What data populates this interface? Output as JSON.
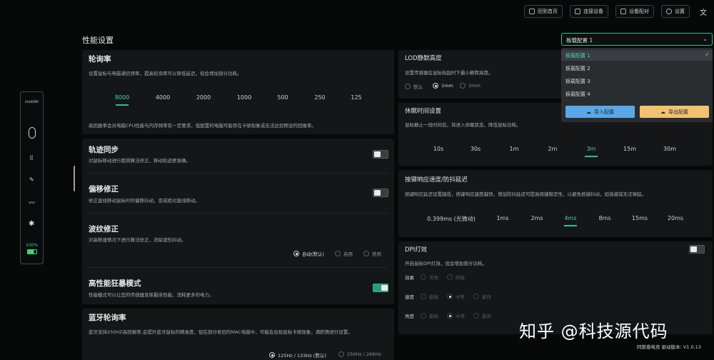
{
  "topbar": {
    "home": "回到首页",
    "connect": "连接设备",
    "device_config": "设备配对",
    "settings": "设置"
  },
  "page_title": "性能设置",
  "profile": {
    "selected": "板载配置 1",
    "options": [
      "板载配置 1",
      "板载配置 2",
      "板载配置 3",
      "板载配置 4"
    ],
    "import_label": "导入配置",
    "export_label": "导出配置"
  },
  "sidebar": {
    "logo": "AULEDRR",
    "battery": "100%"
  },
  "polling": {
    "title": "轮询率",
    "desc": "设置鼠标与电脑通信频率，提高轮询率可以降低延迟，但会增加部分功耗。",
    "options": [
      "8000",
      "4000",
      "2000",
      "1000",
      "500",
      "250",
      "125"
    ],
    "selected": "8000",
    "note": "高回报率会对电脑CPU性能与内存频率有一定要求，低配置的电脑可能存在卡顿现象或无法达到预设的回报率。"
  },
  "track_sync": {
    "title": "轨迹同步",
    "desc": "对鼠标移动进行圆滑算法修正，移动轨迹更准确。",
    "enabled": false
  },
  "offset": {
    "title": "偏移修正",
    "desc": "修正直线移动鼠标时的偏移抖动，变成绝对直线移动。",
    "enabled": false
  },
  "ripple": {
    "title": "波纹修正",
    "desc": "对高移速情况下进行算法修正，消除波形抖动。",
    "options": [
      "自动(默认)",
      "启用",
      "禁用"
    ],
    "selected": "自动(默认)"
  },
  "high_perf": {
    "title": "高性能狂暴模式",
    "desc": "性能模式可以让您的传感器发挥最佳性能，消耗更多的电力。",
    "enabled": true
  },
  "bt_polling": {
    "title": "蓝牙轮询率",
    "desc": "蓝牙支持250HZ高回报率,会提升蓝牙鼠标的精准度，但在部分老旧的MAC电脑中，可能会出现鼠标卡顿现象，请酌情进行设置。",
    "options": [
      "125Hz / 133Hz (默认)",
      "250Hz / 266Hz"
    ],
    "selected": "125Hz / 133Hz (默认)"
  },
  "lod": {
    "title": "LOD静默高度",
    "desc": "设置传感器在鼠标抬起时下最小静默高度。",
    "options": [
      "默认",
      "1mm",
      "2mm"
    ],
    "selected": "1mm"
  },
  "sleep": {
    "title": "休眠时间设置",
    "desc": "鼠标静止一段时间后，将进入休眠状态，降低鼠标功耗。",
    "options": [
      "10s",
      "30s",
      "1m",
      "2m",
      "3m",
      "15m",
      "30m"
    ],
    "selected": "3m"
  },
  "debounce": {
    "title": "按键响应速度/防抖延迟",
    "desc": "按键响应延迟设置越低，按键响应速度越快，增加防抖延迟可提高按键稳定性，以避免按键抖动，如连键或无法弹起。",
    "options": [
      "0.399ms (光微动)",
      "1ms",
      "2ms",
      "4ms",
      "8ms",
      "15ms",
      "20ms"
    ],
    "selected": "4ms"
  },
  "dpi_light": {
    "title": "DPI灯效",
    "desc": "开启鼠标DPI灯效，但会增加部分功耗。",
    "enabled": false,
    "effect_label": "效果",
    "effect_options": [
      "常亮",
      "呼吸"
    ],
    "speed_label": "速度",
    "speed_options": [
      "最慢",
      "中等",
      "最快"
    ],
    "speed_selected": "中等",
    "bright_label": "亮度",
    "bright_options": [
      "最暗",
      "中等",
      "最亮"
    ],
    "bright_selected": "中等"
  },
  "watermark": "知乎 @科技源代码",
  "version": "阿斯盾电竞 驱动版本: V1.0.13"
}
